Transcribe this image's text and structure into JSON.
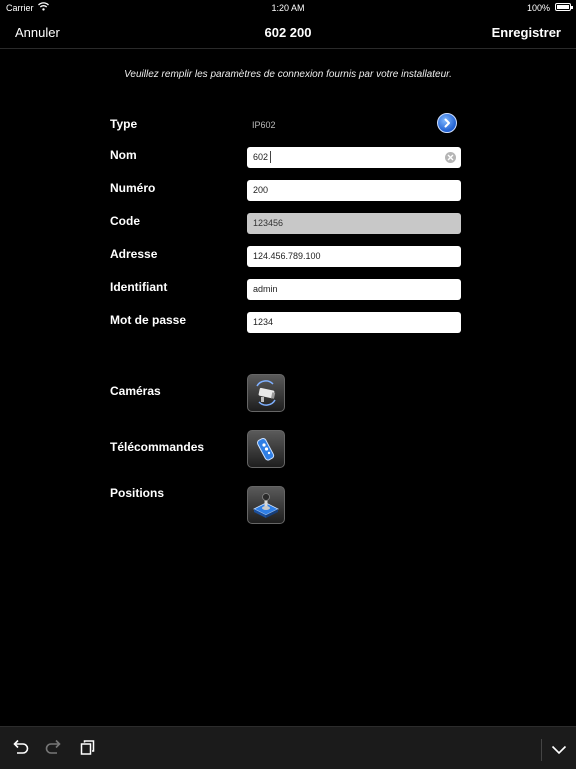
{
  "status_bar": {
    "carrier": "Carrier",
    "time": "1:20 AM",
    "battery": "100%"
  },
  "nav": {
    "cancel": "Annuler",
    "title": "602 200",
    "save": "Enregistrer"
  },
  "instructions": "Veuillez remplir les paramètres de connexion fournis par votre installateur.",
  "form": {
    "type": {
      "label": "Type",
      "value": "IP602"
    },
    "name": {
      "label": "Nom",
      "value": "602"
    },
    "number": {
      "label": "Numéro",
      "value": "200"
    },
    "code": {
      "label": "Code",
      "value": "123456"
    },
    "address": {
      "label": "Adresse",
      "value": "124.456.789.100"
    },
    "username": {
      "label": "Identifiant",
      "value": "admin"
    },
    "password": {
      "label": "Mot de passe",
      "value": "1234"
    }
  },
  "options": {
    "cameras": {
      "label": "Caméras",
      "icon": "security-camera-icon"
    },
    "remotes": {
      "label": "Télécommandes",
      "icon": "remote-control-icon"
    },
    "positions": {
      "label": "Positions",
      "icon": "joystick-icon"
    }
  },
  "toolbar_icons": [
    "undo-icon",
    "redo-icon",
    "copy-icon",
    "chevron-down-icon"
  ]
}
